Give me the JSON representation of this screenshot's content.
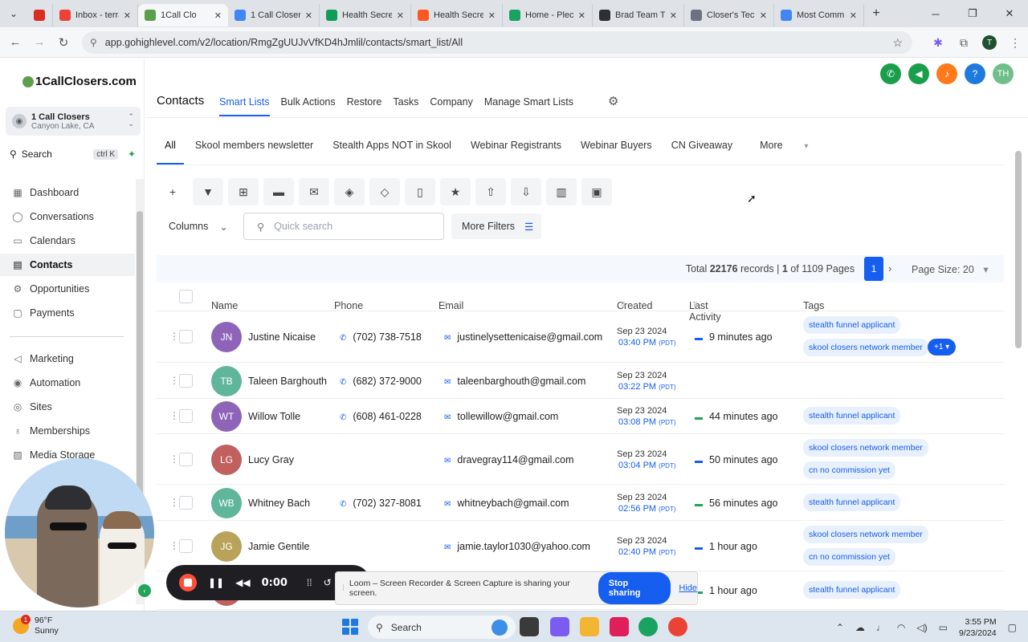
{
  "browser": {
    "tabs": [
      {
        "label": "",
        "color": "#d92d20",
        "width": 32
      },
      {
        "label": "Inbox - terra",
        "color": "#ea4335",
        "width": 106
      },
      {
        "label": "1Call Clo",
        "color": "#5aa04a",
        "width": 112,
        "active": true
      },
      {
        "label": "1 Call Closer",
        "color": "#4285f4",
        "width": 114
      },
      {
        "label": "Health Secre",
        "color": "#0f9d58",
        "width": 114
      },
      {
        "label": "Health Secre",
        "color": "#ff5722",
        "width": 114
      },
      {
        "label": "Home - Plec",
        "color": "#1aa260",
        "width": 112
      },
      {
        "label": "Brad Team T",
        "color": "#2d2f33",
        "width": 114
      },
      {
        "label": "Closer's Tec",
        "color": "#6b7280",
        "width": 112
      },
      {
        "label": "Most Comm",
        "color": "#4285f4",
        "width": 112
      }
    ],
    "url": "app.gohighlevel.com/v2/location/RmgZgUUJvVfKD4hJmlil/contacts/smart_list/All",
    "profile_initial": "T"
  },
  "sidebar": {
    "logo": "1CallClosers.com",
    "account_name": "1 Call Closers",
    "account_location": "Canyon Lake, CA",
    "search_label": "Search",
    "search_shortcut": "ctrl K",
    "items": [
      {
        "label": "Dashboard",
        "icon": "dashboard-icon",
        "glyph": "▦"
      },
      {
        "label": "Conversations",
        "icon": "chat-icon",
        "glyph": "◯"
      },
      {
        "label": "Calendars",
        "icon": "calendar-icon",
        "glyph": "▭"
      },
      {
        "label": "Contacts",
        "icon": "contacts-icon",
        "glyph": "▤",
        "active": true
      },
      {
        "label": "Opportunities",
        "icon": "opportunities-icon",
        "glyph": "⚙"
      },
      {
        "label": "Payments",
        "icon": "payments-icon",
        "glyph": "▢"
      },
      {
        "label": "Marketing",
        "icon": "marketing-icon",
        "glyph": "◁"
      },
      {
        "label": "Automation",
        "icon": "automation-icon",
        "glyph": "◉"
      },
      {
        "label": "Sites",
        "icon": "sites-icon",
        "glyph": "◎"
      },
      {
        "label": "Memberships",
        "icon": "memberships-icon",
        "glyph": "♁"
      },
      {
        "label": "Media Storage",
        "icon": "media-icon",
        "glyph": "▨"
      }
    ]
  },
  "header": {
    "title": "Contacts",
    "nav": [
      {
        "label": "Smart Lists",
        "active": true
      },
      {
        "label": "Bulk Actions"
      },
      {
        "label": "Restore"
      },
      {
        "label": "Tasks"
      },
      {
        "label": "Company"
      },
      {
        "label": "Manage Smart Lists"
      }
    ],
    "user_initials": "TH",
    "circle_buttons": [
      {
        "icon": "phone-icon",
        "glyph": "✆",
        "color": "#1a9e4b"
      },
      {
        "icon": "megaphone-icon",
        "glyph": "◀",
        "color": "#1a9e4b"
      },
      {
        "icon": "bell-icon",
        "glyph": "♪",
        "color": "#ff7a1a"
      },
      {
        "icon": "help-icon",
        "glyph": "?",
        "color": "#1f7ae0"
      }
    ]
  },
  "smart_lists": {
    "tabs": [
      "All",
      "Skool members newsletter",
      "Stealth Apps NOT in Skool",
      "Webinar Registrants",
      "Webinar Buyers",
      "CN Giveaway"
    ],
    "more_label": "More"
  },
  "toolbar": {
    "icons": [
      {
        "name": "add-contact-icon",
        "glyph": "+"
      },
      {
        "name": "filter-icon",
        "glyph": "▼"
      },
      {
        "name": "workflow-icon",
        "glyph": "⊞"
      },
      {
        "name": "sms-icon",
        "glyph": "▬"
      },
      {
        "name": "email-icon",
        "glyph": "✉"
      },
      {
        "name": "add-tag-icon",
        "glyph": "◈"
      },
      {
        "name": "remove-tag-icon",
        "glyph": "◇"
      },
      {
        "name": "delete-icon",
        "glyph": "▯"
      },
      {
        "name": "star-icon",
        "glyph": "★"
      },
      {
        "name": "export-icon",
        "glyph": "⇧"
      },
      {
        "name": "import-icon",
        "glyph": "⇩"
      },
      {
        "name": "company-icon",
        "glyph": "▥"
      },
      {
        "name": "merge-icon",
        "glyph": "▣"
      }
    ],
    "columns_label": "Columns",
    "search_placeholder": "Quick search",
    "more_filters_label": "More Filters"
  },
  "pagination": {
    "total_label": "Total",
    "total_records": "22176",
    "records_word": "records |",
    "current_page": "1",
    "of_label": "of 1109 Pages",
    "page_size_label": "Page Size: 20"
  },
  "table": {
    "columns": [
      "Name",
      "Phone",
      "Email",
      "Created",
      "Last Activity",
      "Tags"
    ],
    "rows": [
      {
        "initials": "JN",
        "avatar_color": "#8e64b8",
        "name": "Justine Nicaise",
        "phone": "(702) 738-7518",
        "email": "justinelysettenicaise@gmail.com",
        "date": "Sep 23 2024",
        "time": "03:40 PM",
        "tz": "(PDT)",
        "activity": "9 minutes ago",
        "activity_color": "#155eef",
        "tags": [
          "stealth funnel applicant",
          "skool closers network member"
        ],
        "extra_tags": "+1"
      },
      {
        "initials": "TB",
        "avatar_color": "#5fb69a",
        "name": "Taleen Barghouth",
        "phone": "(682) 372-9000",
        "email": "taleenbarghouth@gmail.com",
        "date": "Sep 23 2024",
        "time": "03:22 PM",
        "tz": "(PDT)",
        "activity": "",
        "activity_color": "",
        "tags": []
      },
      {
        "initials": "WT",
        "avatar_color": "#8e64b8",
        "name": "Willow Tolle",
        "phone": "(608) 461-0228",
        "email": "tollewillow@gmail.com",
        "date": "Sep 23 2024",
        "time": "03:08 PM",
        "tz": "(PDT)",
        "activity": "44 minutes ago",
        "activity_color": "#22a35a",
        "tags": [
          "stealth funnel applicant"
        ]
      },
      {
        "initials": "LG",
        "avatar_color": "#c0605f",
        "name": "Lucy Gray",
        "phone": "",
        "email": "dravegray114@gmail.com",
        "date": "Sep 23 2024",
        "time": "03:04 PM",
        "tz": "(PDT)",
        "activity": "50 minutes ago",
        "activity_color": "#155eef",
        "tags": [
          "skool closers network member",
          "cn no commission yet"
        ]
      },
      {
        "initials": "WB",
        "avatar_color": "#5fb69a",
        "name": "Whitney Bach",
        "phone": "(702) 327-8081",
        "email": "whitneybach@gmail.com",
        "date": "Sep 23 2024",
        "time": "02:56 PM",
        "tz": "(PDT)",
        "activity": "56 minutes ago",
        "activity_color": "#22a35a",
        "tags": [
          "stealth funnel applicant"
        ]
      },
      {
        "initials": "JG",
        "avatar_color": "#b9a35a",
        "name": "Jamie Gentile",
        "phone": "",
        "email": "jamie.taylor1030@yahoo.com",
        "date": "Sep 23 2024",
        "time": "02:40 PM",
        "tz": "(PDT)",
        "activity": "1 hour ago",
        "activity_color": "#155eef",
        "tags": [
          "skool closers network member",
          "cn no commission yet"
        ]
      },
      {
        "initials": "",
        "avatar_color": "#c0605f",
        "name": "",
        "phone": "",
        "email": "",
        "date": "",
        "time": "",
        "tz": "",
        "activity": "1 hour ago",
        "activity_color": "#22a35a",
        "tags": [
          "stealth funnel applicant"
        ]
      }
    ]
  },
  "loom": {
    "time": "0:00",
    "message": "Loom – Screen Recorder & Screen Capture is sharing your screen.",
    "stop_label": "Stop sharing",
    "hide_label": "Hide"
  },
  "taskbar": {
    "notification_count": "1",
    "temperature": "96°F",
    "condition": "Sunny",
    "search_label": "Search",
    "time": "3:55 PM",
    "date": "9/23/2024",
    "apps": [
      {
        "name": "file-manager-icon",
        "color": "#3a3a3a"
      },
      {
        "name": "copilot-icon",
        "color": "#7b5cf0"
      },
      {
        "name": "folder-icon",
        "color": "#f2b632"
      },
      {
        "name": "slack-icon",
        "color": "#e01e5a"
      },
      {
        "name": "chrome-icon",
        "color": "#1aa260"
      },
      {
        "name": "chrome-profile-icon",
        "color": "#ea4335"
      }
    ]
  }
}
